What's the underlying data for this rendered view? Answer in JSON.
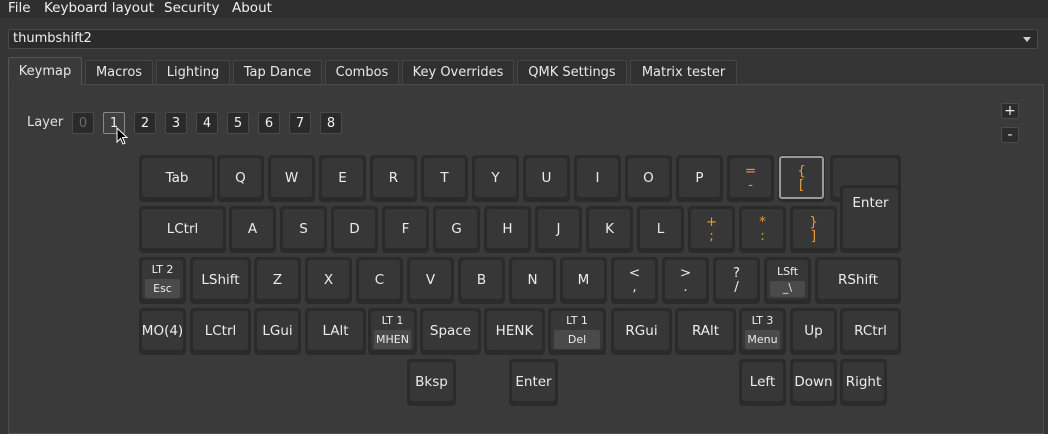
{
  "menubar": {
    "items": [
      "File",
      "Keyboard layout",
      "Security",
      "About"
    ]
  },
  "keyboard_select": {
    "value": "thumbshift2"
  },
  "tabs": [
    "Keymap",
    "Macros",
    "Lighting",
    "Tap Dance",
    "Combos",
    "Key Overrides",
    "QMK Settings",
    "Matrix tester"
  ],
  "active_tab": "Keymap",
  "layer": {
    "label": "Layer",
    "buttons": [
      "0",
      "1",
      "2",
      "3",
      "4",
      "5",
      "6",
      "7",
      "8"
    ],
    "active": "1",
    "disabled": "0"
  },
  "side_buttons": {
    "plus": "+",
    "minus": "-"
  },
  "keys": {
    "tab": "Tab",
    "q": "Q",
    "w": "W",
    "e": "E",
    "r": "R",
    "t": "T",
    "y": "Y",
    "u": "U",
    "i": "I",
    "o": "O",
    "p": "P",
    "eq_top": "=",
    "eq_bot": "-",
    "brace_top": "{",
    "brace_bot": "[",
    "enter": "Enter",
    "lctrl": "LCtrl",
    "a": "A",
    "s": "S",
    "d": "D",
    "f": "F",
    "g": "G",
    "h": "H",
    "j": "J",
    "k": "K",
    "l": "L",
    "plus_top": "+",
    "plus_bot": ";",
    "star_top": "*",
    "star_bot": ":",
    "rbrace_top": "}",
    "rbrace_bot": "]",
    "lt2_top": "LT 2",
    "lt2_bot": "Esc",
    "lshift": "LShift",
    "z": "Z",
    "x": "X",
    "c": "C",
    "v": "V",
    "b": "B",
    "n": "N",
    "m": "M",
    "lt_top": "<",
    "lt_bot": ",",
    "gt_top": ">",
    "gt_bot": ".",
    "q_top": "?",
    "q_bot": "/",
    "lsft_top": "LSft",
    "lsft_bot": "_\\",
    "rshift": "RShift",
    "mo4": "MO(4)",
    "lctrl2": "LCtrl",
    "lgui": "LGui",
    "lalt": "LAlt",
    "lt1a_top": "LT 1",
    "lt1a_bot": "MHEN",
    "space": "Space",
    "henk": "HENK",
    "lt1b_top": "LT 1",
    "lt1b_bot": "Del",
    "rgui": "RGui",
    "ralt": "RAlt",
    "lt3_top": "LT 3",
    "lt3_bot": "Menu",
    "up": "Up",
    "rctrl": "RCtrl",
    "bksp": "Bksp",
    "enter2": "Enter",
    "left": "Left",
    "down": "Down",
    "right": "Right"
  },
  "colors": {
    "accent_orange": "#e89a35",
    "background": "#353535"
  }
}
